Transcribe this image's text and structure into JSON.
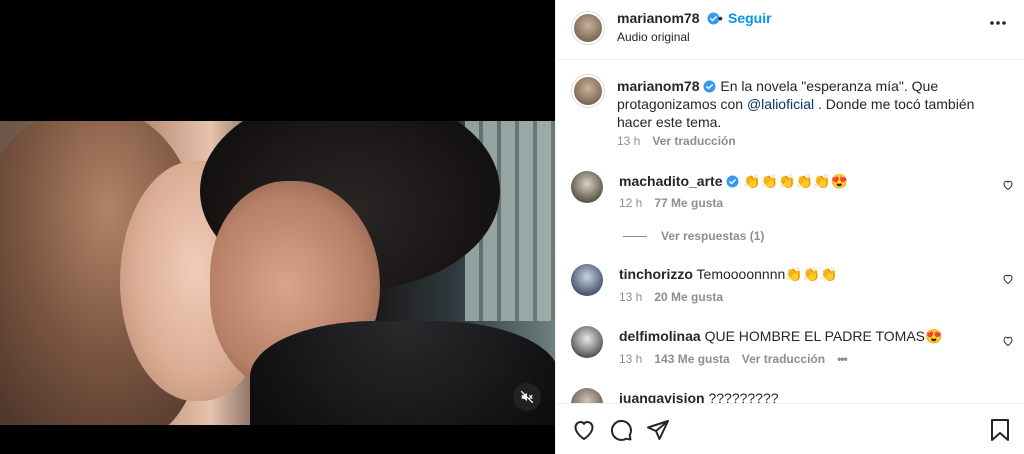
{
  "post": {
    "author": "marianom78",
    "follow_label": "Seguir",
    "dot": "•",
    "audio": "Audio original"
  },
  "caption": {
    "author": "marianom78",
    "text_before": "En la novela \"esperanza mía\". Que protagonizamos con ",
    "mention": "@lalioficial",
    "text_after": " . Donde me tocó también hacer este tema.",
    "time": "13 h",
    "translate": "Ver traducción"
  },
  "comments": [
    {
      "user": "machadito_arte",
      "verified": true,
      "text": "👏👏👏👏👏😍",
      "time": "12 h",
      "likes": "77 Me gusta",
      "replies": "Ver respuestas (1)"
    },
    {
      "user": "tinchorizzo",
      "verified": false,
      "text": "Temoooonnnn👏👏👏",
      "time": "13 h",
      "likes": "20 Me gusta"
    },
    {
      "user": "delfimolinaa",
      "verified": false,
      "text": "QUE HOMBRE EL PADRE TOMAS😍",
      "time": "13 h",
      "likes": "143 Me gusta",
      "translate": "Ver traducción",
      "more": "•••"
    },
    {
      "user": "juangavision",
      "verified": false,
      "text": "?????????"
    }
  ],
  "colors": {
    "accent": "#0095f6",
    "verified": "#3897f0",
    "mention": "#00376b"
  }
}
